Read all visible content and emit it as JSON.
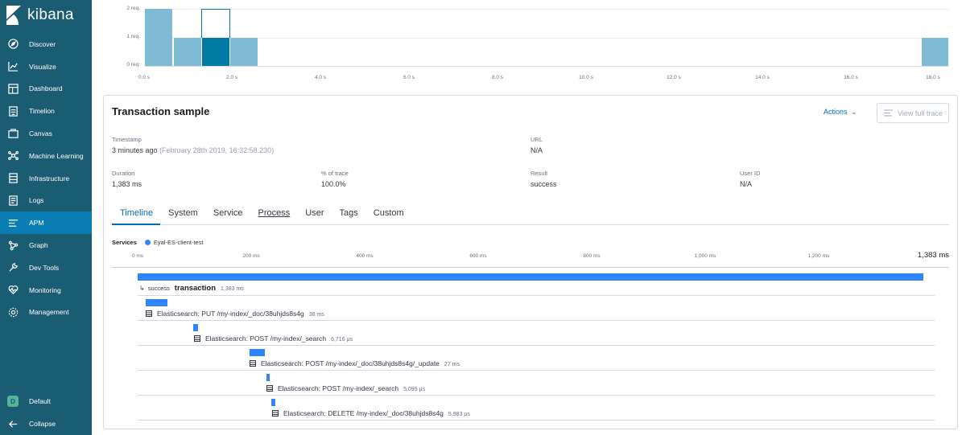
{
  "sidebar": {
    "logo": "kibana",
    "items": [
      {
        "label": "Discover",
        "icon": "compass-icon"
      },
      {
        "label": "Visualize",
        "icon": "chart-icon"
      },
      {
        "label": "Dashboard",
        "icon": "dashboard-icon"
      },
      {
        "label": "Timelion",
        "icon": "timelion-icon"
      },
      {
        "label": "Canvas",
        "icon": "canvas-icon"
      },
      {
        "label": "Machine Learning",
        "icon": "ml-icon"
      },
      {
        "label": "Infrastructure",
        "icon": "infrastructure-icon"
      },
      {
        "label": "Logs",
        "icon": "logs-icon"
      },
      {
        "label": "APM",
        "icon": "apm-icon",
        "active": true
      },
      {
        "label": "Graph",
        "icon": "graph-icon"
      },
      {
        "label": "Dev Tools",
        "icon": "wrench-icon"
      },
      {
        "label": "Monitoring",
        "icon": "heartbeat-icon"
      },
      {
        "label": "Management",
        "icon": "gear-icon"
      }
    ],
    "space_initial": "D",
    "space_label": "Default",
    "collapse_label": "Collapse"
  },
  "histogram": {
    "y_ticks": [
      "2 req.",
      "1 req.",
      "0 req."
    ],
    "x_ticks": [
      "0.0 s",
      "2.0 s",
      "4.0 s",
      "6.0 s",
      "8.0 s",
      "10.0 s",
      "12.0 s",
      "14.0 s",
      "16.0 s",
      "18.0 s"
    ],
    "colors": {
      "bar": "#7fbbd4",
      "selected": "#0079a5"
    }
  },
  "panel": {
    "title": "Transaction sample",
    "actions_label": "Actions",
    "view_trace_label": "View full trace",
    "timestamp": {
      "label": "Timestamp",
      "relative": "3 minutes ago",
      "absolute": "(February 28th 2019, 16:32:58.230)"
    },
    "url": {
      "label": "URL",
      "value": "N/A"
    },
    "duration": {
      "label": "Duration",
      "value": "1,383 ms"
    },
    "pct_trace": {
      "label": "% of trace",
      "value": "100.0%"
    },
    "result": {
      "label": "Result",
      "value": "success"
    },
    "user_id": {
      "label": "User ID",
      "value": "N/A"
    },
    "tabs": [
      "Timeline",
      "System",
      "Service",
      "Process",
      "User",
      "Tags",
      "Custom"
    ],
    "services_label": "Services",
    "service_name": "Eyal-ES-client-test",
    "timeline_ticks": [
      "0 ms",
      "200 ms",
      "400 ms",
      "600 ms",
      "800 ms",
      "1,000 ms",
      "1,200 ms"
    ],
    "timeline_total": "1,383 ms",
    "transaction": {
      "result": "success",
      "name": "transaction",
      "duration": "1,383 ms"
    },
    "spans": [
      {
        "name": "Elasticsearch: PUT /my-index/_doc/38uhjds8s4g",
        "duration": "38 ms"
      },
      {
        "name": "Elasticsearch: POST /my-index/_search",
        "duration": "6,716 μs"
      },
      {
        "name": "Elasticsearch: POST /my-index/_doc/38uhjds8s4g/_update",
        "duration": "27 ms"
      },
      {
        "name": "Elasticsearch: POST /my-index/_search",
        "duration": "5,099 μs"
      },
      {
        "name": "Elasticsearch: DELETE /my-index/_doc/38uhjds8s4g",
        "duration": "5,983 μs"
      }
    ]
  }
}
